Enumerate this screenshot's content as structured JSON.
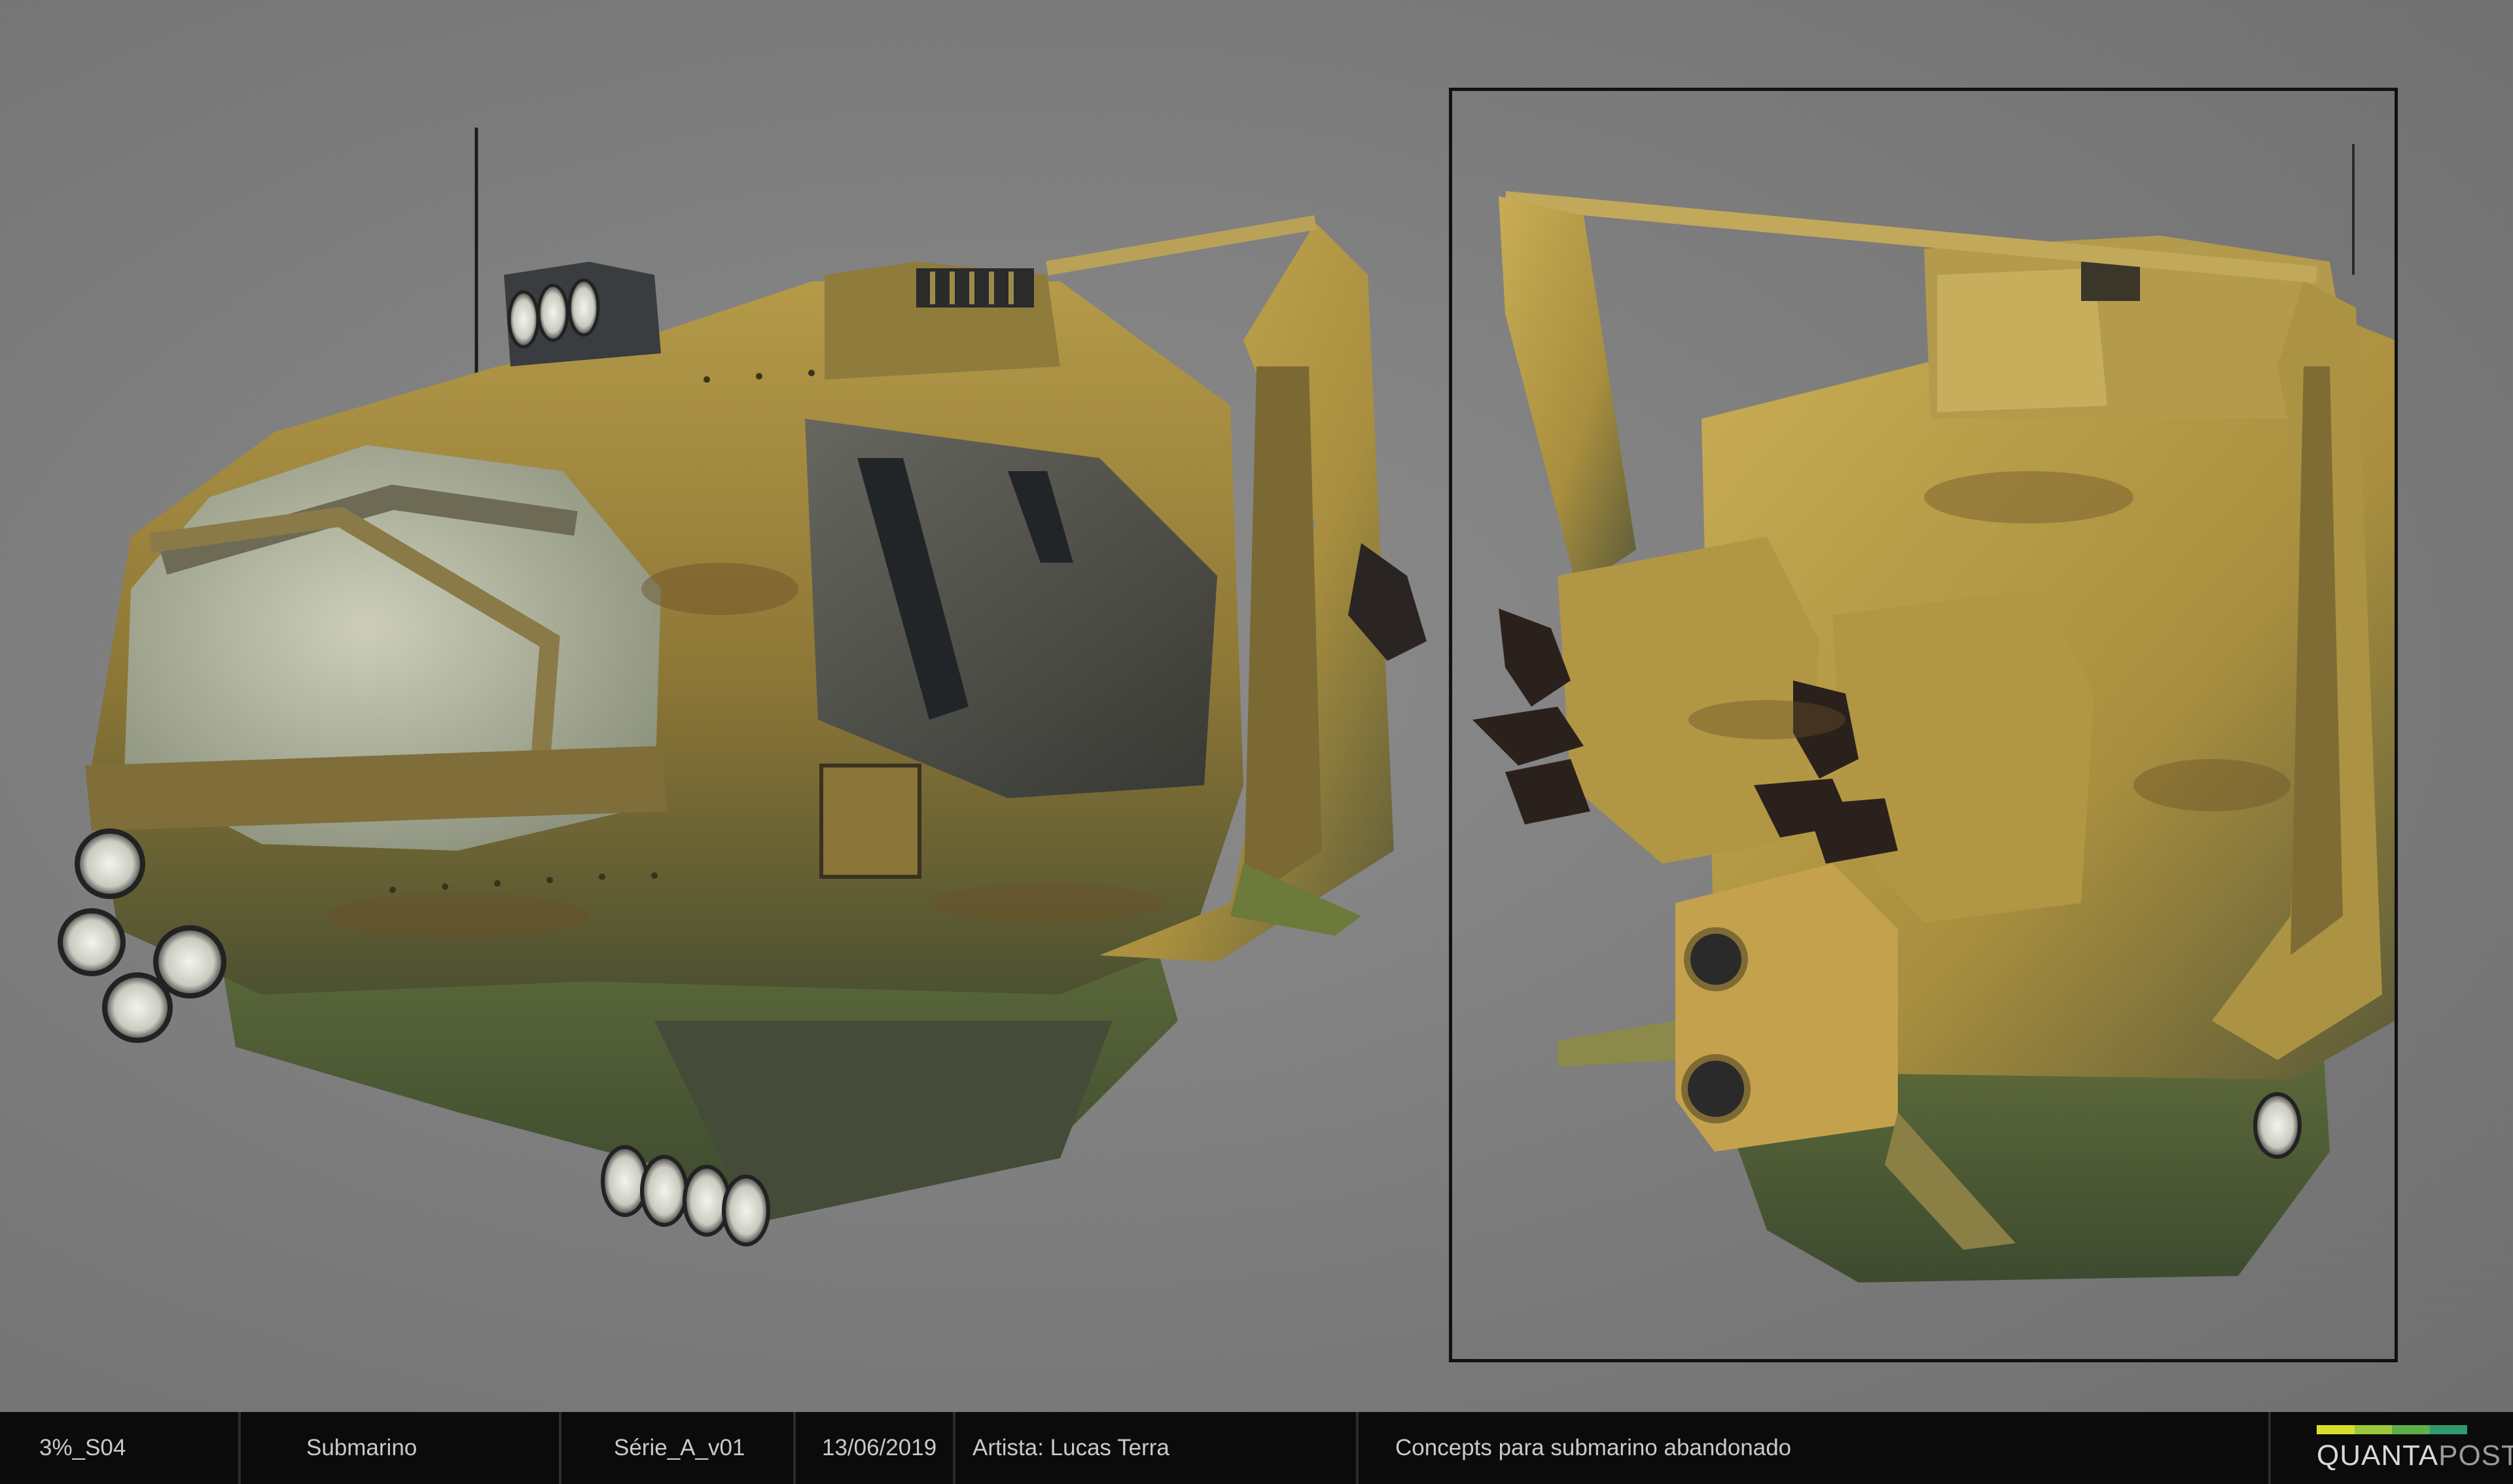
{
  "info_bar": {
    "project_code": "3%_S04",
    "asset_name": "Submarino",
    "version": "Série_A_v01",
    "date": "13/06/2019",
    "artist": "Artista: Lucas Terra",
    "description": "Concepts para submarino abandonado"
  },
  "logo": {
    "name_left": "QUANTA",
    "name_right": "POST",
    "stripe_colors": [
      "#d9de2e",
      "#9cc83a",
      "#5fae4a",
      "#2f9a6d"
    ]
  },
  "colors": {
    "background": "#7b7b7b",
    "hull_yellow": "#a8913f",
    "rust": "#6e5530",
    "dark_metal": "#3f4347",
    "moss": "#4f5e33",
    "glass": "#b9bba7"
  }
}
